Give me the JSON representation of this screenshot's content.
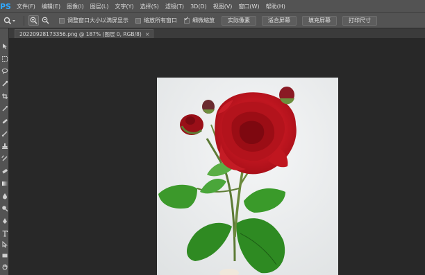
{
  "app": {
    "logo_text": "PS"
  },
  "menu": [
    "文件(F)",
    "编辑(E)",
    "图像(I)",
    "图层(L)",
    "文字(Y)",
    "选择(S)",
    "滤镜(T)",
    "3D(D)",
    "视图(V)",
    "窗口(W)",
    "帮助(H)"
  ],
  "options": {
    "checkboxes": [
      {
        "label": "调整窗口大小以满屏显示",
        "checked": false
      },
      {
        "label": "缩放所有窗口",
        "checked": false
      },
      {
        "label": "细微缩放",
        "checked": true
      }
    ],
    "buttons": [
      "实际像素",
      "适合屏幕",
      "填充屏幕",
      "打印尺寸"
    ]
  },
  "document": {
    "tab_title": "20220928173356.png @ 187% (图层 0, RGB/8)",
    "close_symbol": "×"
  },
  "colors": {
    "bg": "#282828",
    "panel": "#535353",
    "rose": "#b1121b",
    "leaf": "#2f8a22"
  }
}
